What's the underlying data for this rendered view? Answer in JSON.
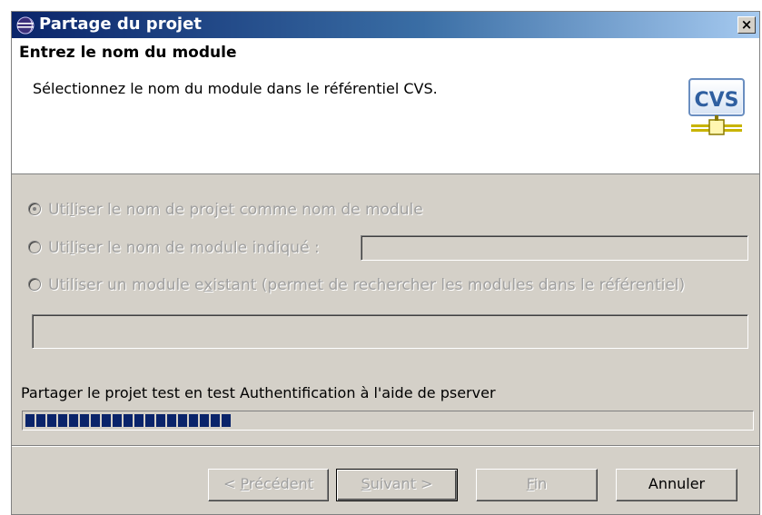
{
  "window": {
    "title": "Partage du projet",
    "close_glyph": "×",
    "app_icon": "eclipse-icon"
  },
  "header": {
    "title": "Entrez le nom du module",
    "description": "Sélectionnez le nom du module dans le référentiel CVS.",
    "logo_text": "CVS",
    "logo_icon": "cvs-repository-icon"
  },
  "options": {
    "use_project_name": {
      "label_pre": "Uti",
      "label_mnemonic": "l",
      "label_post": "iser le nom de projet comme nom de module",
      "checked": true
    },
    "use_specified_name": {
      "label_pre": "Uti",
      "label_mnemonic": "l",
      "label_post": "iser le nom de module indiqué :",
      "checked": false,
      "value": ""
    },
    "use_existing_module": {
      "label_pre": "Utiliser un module e",
      "label_mnemonic": "x",
      "label_post": "istant (permet de rechercher les modules dans le référentiel)",
      "checked": false,
      "value": ""
    }
  },
  "status": {
    "text": "Partager le projet test en test Authentification à l'aide de pserver",
    "progress_blocks": 19,
    "progress_color": "#0a246a"
  },
  "buttons": {
    "back": {
      "pre": "< ",
      "mnemonic": "P",
      "post": "récédent"
    },
    "next": {
      "pre": "",
      "mnemonic": "S",
      "post": "uivant >"
    },
    "finish": {
      "pre": "",
      "mnemonic": "F",
      "post": "in"
    },
    "cancel": {
      "label": "Annuler"
    }
  }
}
